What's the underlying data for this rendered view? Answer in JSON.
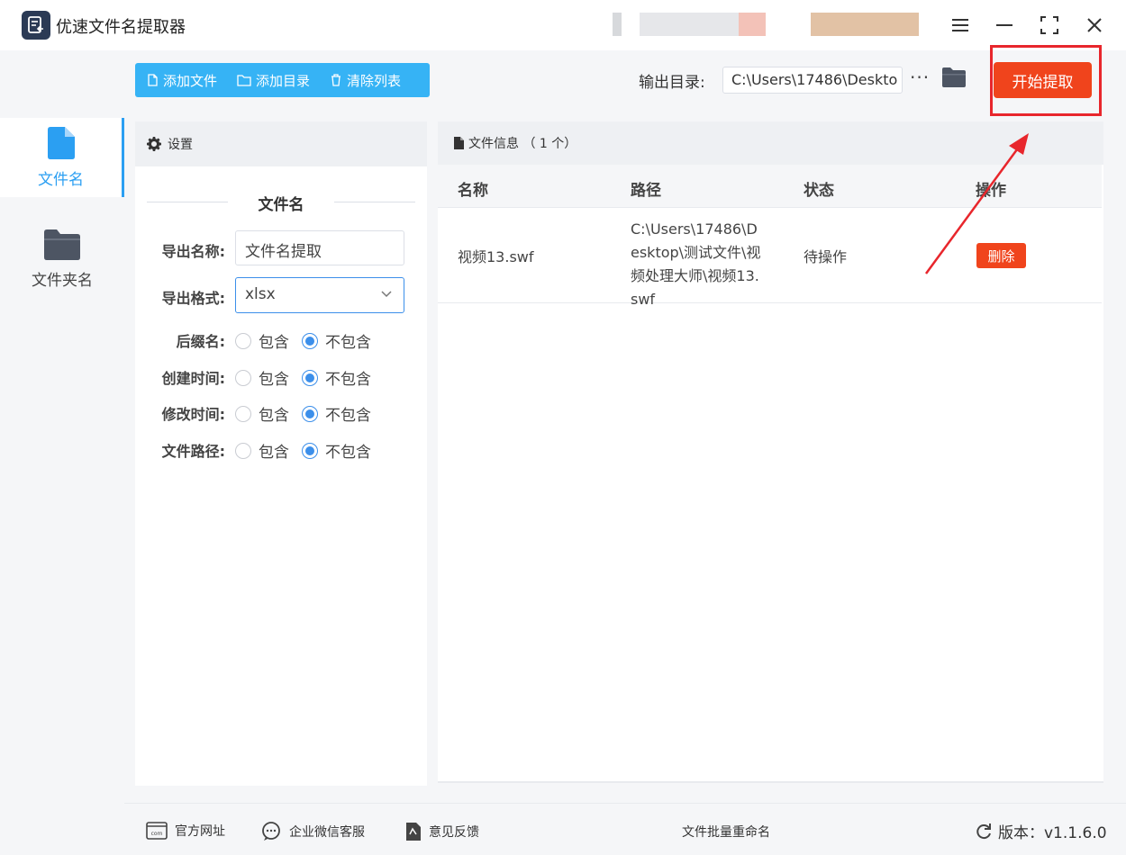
{
  "window": {
    "title": "优速文件名提取器"
  },
  "sidebar": {
    "items": [
      {
        "label": "文件名",
        "icon": "file-icon",
        "active": true
      },
      {
        "label": "文件夹名",
        "icon": "folder-icon",
        "active": false
      }
    ]
  },
  "toolbar": {
    "add_file": "添加文件",
    "add_dir": "添加目录",
    "clear_list": "清除列表",
    "output_label": "输出目录:",
    "output_path": "C:\\Users\\17486\\Deskto",
    "more": "···",
    "start": "开始提取"
  },
  "settings": {
    "header": "设置",
    "section_title": "文件名",
    "export_name_label": "导出名称:",
    "export_name_value": "文件名提取",
    "export_format_label": "导出格式:",
    "export_format_value": "xlsx",
    "options": [
      {
        "label": "后缀名:",
        "include": "包含",
        "exclude": "不包含",
        "selected": "exclude"
      },
      {
        "label": "创建时间:",
        "include": "包含",
        "exclude": "不包含",
        "selected": "exclude"
      },
      {
        "label": "修改时间:",
        "include": "包含",
        "exclude": "不包含",
        "selected": "exclude"
      },
      {
        "label": "文件路径:",
        "include": "包含",
        "exclude": "不包含",
        "selected": "exclude"
      }
    ]
  },
  "files": {
    "header": "文件信息 （ 1 个）",
    "columns": [
      "名称",
      "路径",
      "状态",
      "操作"
    ],
    "rows": [
      {
        "name": "视频13.swf",
        "path": "C:\\Users\\17486\\Desktop\\测试文件\\视频处理大师\\视频13.swf",
        "status": "待操作",
        "action": "删除"
      }
    ]
  },
  "footer": {
    "website": "官方网址",
    "wechat": "企业微信客服",
    "feedback": "意见反馈",
    "center": "文件批量重命名",
    "version": "版本：v1.1.6.0"
  },
  "colors": {
    "accent": "#2b9ff2",
    "toolbar": "#36b3f5",
    "danger": "#f0441c",
    "highlight": "#e8262c"
  }
}
